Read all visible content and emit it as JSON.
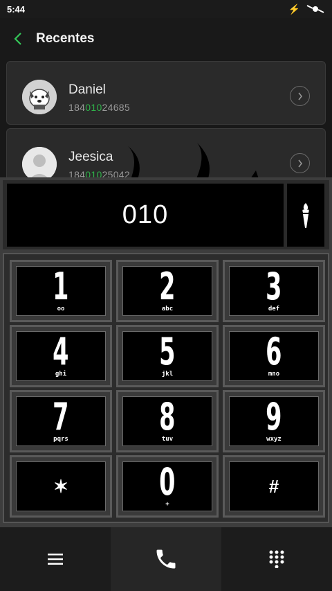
{
  "status": {
    "time": "5:44"
  },
  "header": {
    "title": "Recentes"
  },
  "recents": [
    {
      "name": "Daniel",
      "number_pre": "184",
      "number_match": "010",
      "number_post": "24685"
    },
    {
      "name": "Jeesica",
      "number_pre": "184",
      "number_match": "010",
      "number_post": "25042"
    }
  ],
  "dialer": {
    "input": "010",
    "keys": [
      {
        "digit": "1",
        "letters": "oo"
      },
      {
        "digit": "2",
        "letters": "abc"
      },
      {
        "digit": "3",
        "letters": "def"
      },
      {
        "digit": "4",
        "letters": "ghi"
      },
      {
        "digit": "5",
        "letters": "jkl"
      },
      {
        "digit": "6",
        "letters": "mno"
      },
      {
        "digit": "7",
        "letters": "pqrs"
      },
      {
        "digit": "8",
        "letters": "tuv"
      },
      {
        "digit": "9",
        "letters": "wxyz"
      },
      {
        "digit": "✶",
        "letters": ""
      },
      {
        "digit": "0",
        "letters": "+"
      },
      {
        "digit": "#",
        "letters": ""
      }
    ]
  },
  "colors": {
    "match_highlight": "#2fb34a",
    "back_arrow": "#34c759"
  }
}
